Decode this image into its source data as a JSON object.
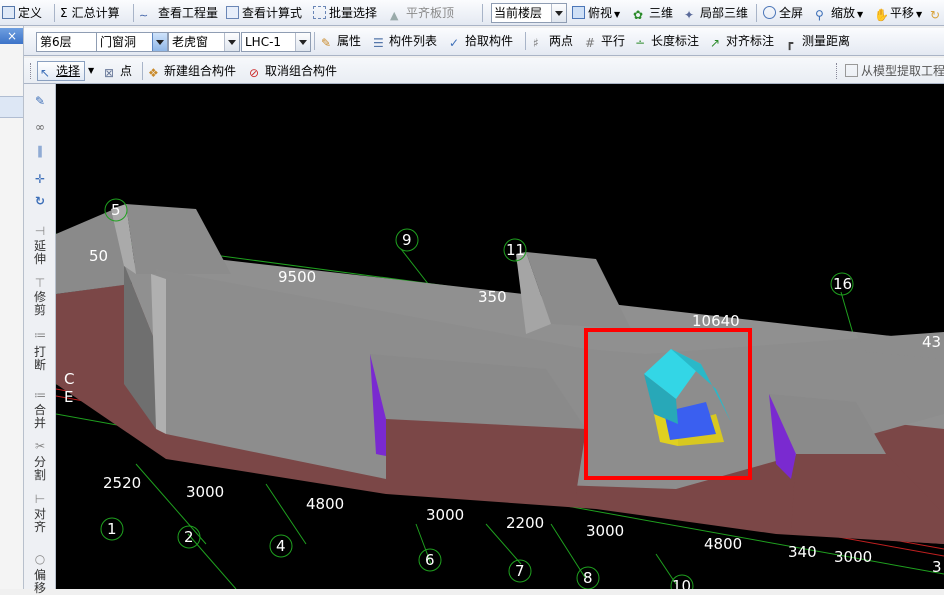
{
  "toolbar1": {
    "define": "定义",
    "sum_calc": "汇总计算",
    "view_quantity": "查看工程量",
    "view_formula": "查看计算式",
    "batch_select": "批量选择",
    "flush_slab": "平齐板顶",
    "floor_scope": "当前楼层",
    "top_view": "俯视",
    "three_d": "三维",
    "local_3d": "局部三维",
    "fullscreen": "全屏",
    "zoom": "缩放",
    "pan": "平移"
  },
  "toolbar2": {
    "floor": "第6层",
    "category": "门窗洞",
    "component_type": "老虎窗",
    "component_name": "LHC-1",
    "properties": "属性",
    "component_list": "构件列表",
    "pick_component": "拾取构件",
    "two_points": "两点",
    "parallel": "平行",
    "length_dim": "长度标注",
    "align_dim": "对齐标注",
    "measure": "测量距离"
  },
  "toolbar3": {
    "select": "选择",
    "point": "点",
    "new_group": "新建组合构件",
    "cancel_group": "取消组合构件",
    "extract_from_model": "从模型提取工程"
  },
  "left_panel": {
    "close_glyph": "×"
  },
  "side_tools": {
    "extend": "延伸",
    "trim": "修剪",
    "break": "打断",
    "merge": "合并",
    "split": "分割",
    "align": "对齐",
    "offset": "偏移"
  },
  "viewport": {
    "axis_labels": [
      "5",
      "9",
      "11",
      "16",
      "1",
      "2",
      "4",
      "6",
      "7",
      "8",
      "10",
      "C",
      "E"
    ],
    "dimensions": [
      "50",
      "9500",
      "350",
      "10640",
      "43",
      "2520",
      "3000",
      "4800",
      "3000",
      "2200",
      "3000",
      "4800",
      "340",
      "3000",
      "3"
    ]
  },
  "colors": {
    "highlight_box": "#ff0000",
    "wall": "#6a3a3a",
    "slab": "#8f8f8f",
    "dormer_roof": "#33d6e6",
    "dormer_glass": "#4a6af0",
    "axis": "#00c000"
  }
}
